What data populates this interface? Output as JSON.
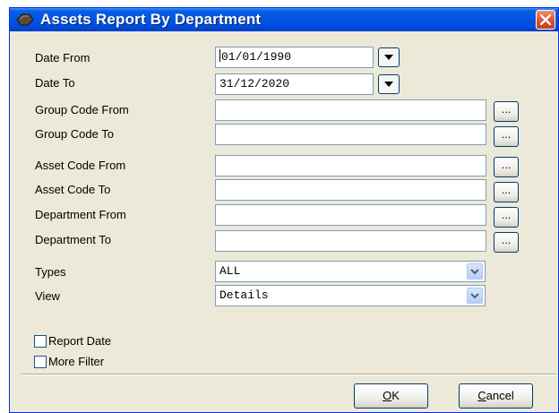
{
  "window": {
    "title": "Assets Report By Department"
  },
  "form": {
    "date_from": {
      "label": "Date From",
      "value": "01/01/1990"
    },
    "date_to": {
      "label": "Date To",
      "value": "31/12/2020"
    },
    "group_code_from": {
      "label": "Group Code From",
      "value": ""
    },
    "group_code_to": {
      "label": "Group Code To",
      "value": ""
    },
    "asset_code_from": {
      "label": "Asset Code From",
      "value": ""
    },
    "asset_code_to": {
      "label": "Asset Code To",
      "value": ""
    },
    "department_from": {
      "label": "Department From",
      "value": ""
    },
    "department_to": {
      "label": "Department To",
      "value": ""
    },
    "types": {
      "label": "Types",
      "value": "ALL"
    },
    "view": {
      "label": "View",
      "value": "Details"
    },
    "lookup_label": "...",
    "report_date": {
      "label": "Report Date",
      "checked": false
    },
    "more_filter": {
      "label": "More Filter",
      "checked": false
    }
  },
  "buttons": {
    "ok": {
      "mnemonic": "O",
      "rest": "K"
    },
    "cancel": {
      "mnemonic": "C",
      "rest": "ancel"
    }
  }
}
